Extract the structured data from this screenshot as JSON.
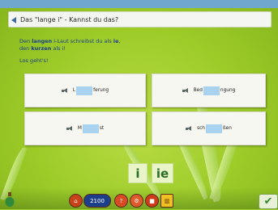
{
  "titlebar": {
    "title": "Das \"lange i\" - Kannst du das?"
  },
  "instruction": {
    "line1_prefix": "Den ",
    "line1_bold": "langen",
    "line1_mid": " i-Laut schreibst du als ",
    "line1_bold2": "ie",
    "line1_end": ",",
    "line2_prefix": "den ",
    "line2_bold": "kurzen",
    "line2_end": " als i!",
    "los": "Los geht's!"
  },
  "cards": [
    {
      "prefix": "L",
      "suffix": "ferung"
    },
    {
      "prefix": "Bed",
      "suffix": "ngung"
    },
    {
      "prefix": "M",
      "suffix": "st"
    },
    {
      "prefix": "sch",
      "suffix": "ßen"
    }
  ],
  "choices": {
    "short": "i",
    "long": "ie"
  },
  "toolbar": {
    "counter": "2100"
  },
  "colors": {
    "accent": "#1d3f8a",
    "gap": "#a9d2ee",
    "grass": "#9fce2a"
  },
  "icons": {
    "back": "arrow-left-icon",
    "speaker": "speaker-icon",
    "ok": "checkmark-icon",
    "bottle": "bottle-icon"
  }
}
